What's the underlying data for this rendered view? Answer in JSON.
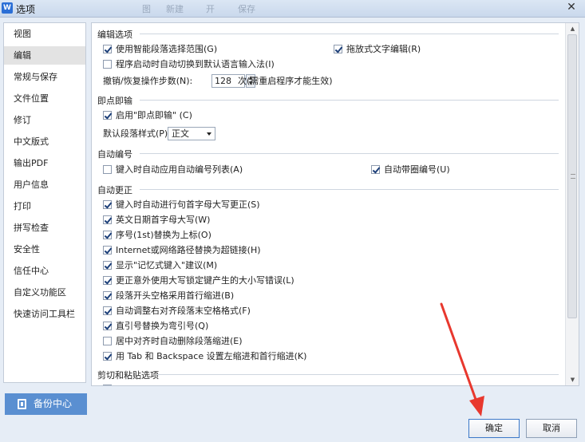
{
  "window": {
    "title": "选项",
    "app_icon": "W",
    "ghost_toolbar": [
      "图",
      "新建",
      "开",
      "保存"
    ]
  },
  "sidebar": {
    "items": [
      {
        "label": "视图"
      },
      {
        "label": "编辑"
      },
      {
        "label": "常规与保存"
      },
      {
        "label": "文件位置"
      },
      {
        "label": "修订"
      },
      {
        "label": "中文版式"
      },
      {
        "label": "输出PDF"
      },
      {
        "label": "用户信息"
      },
      {
        "label": "打印"
      },
      {
        "label": "拼写检查"
      },
      {
        "label": "安全性"
      },
      {
        "label": "信任中心"
      },
      {
        "label": "自定义功能区"
      },
      {
        "label": "快速访问工具栏"
      }
    ],
    "active_index": 1,
    "backup_button": "备份中心"
  },
  "edit_options": {
    "title": "编辑选项",
    "smart_select": {
      "label": "使用智能段落选择范围(G)",
      "checked": true
    },
    "drag_edit": {
      "label": "拖放式文字编辑(R)",
      "checked": true
    },
    "auto_ime": {
      "label": "程序启动时自动切换到默认语言输入法(I)",
      "checked": false
    },
    "undo_label": "撤销/恢复操作步数(N):",
    "undo_value": "128",
    "undo_suffix": "次(需重启程序才能生效)"
  },
  "click_input": {
    "title": "即点即输",
    "enable": {
      "label": "启用\"即点即输\" (C)",
      "checked": true
    },
    "style_label": "默认段落样式(P):",
    "style_value": "正文"
  },
  "auto_number": {
    "title": "自动编号",
    "auto_list": {
      "label": "键入时自动应用自动编号列表(A)",
      "checked": false
    },
    "circled": {
      "label": "自动带圈编号(U)",
      "checked": true
    }
  },
  "auto_correct": {
    "title": "自动更正",
    "items": [
      {
        "label": "键入时自动进行句首字母大写更正(S)",
        "checked": true
      },
      {
        "label": "英文日期首字母大写(W)",
        "checked": true
      },
      {
        "label": "序号(1st)替换为上标(O)",
        "checked": true
      },
      {
        "label": "Internet或网络路径替换为超链接(H)",
        "checked": true
      },
      {
        "label": "显示\"记忆式键入\"建议(M)",
        "checked": true
      },
      {
        "label": "更正意外使用大写锁定键产生的大小写错误(L)",
        "checked": true
      },
      {
        "label": "段落开头空格采用首行缩进(B)",
        "checked": true
      },
      {
        "label": "自动调整右对齐段落末空格格式(F)",
        "checked": true
      },
      {
        "label": "直引号替换为弯引号(Q)",
        "checked": true
      },
      {
        "label": "居中对齐时自动删除段落缩进(E)",
        "checked": false
      },
      {
        "label": "用 Tab 和 Backspace 设置左缩进和首行缩进(K)",
        "checked": true
      }
    ]
  },
  "paste_options": {
    "title": "剪切和粘贴选项"
  },
  "footer": {
    "ok_label": "确定",
    "cancel_label": "取消"
  },
  "colors": {
    "backup_button_bg": "#5a8fd1",
    "annotation_arrow": "#e8382e",
    "checkmark": "#1c3f79"
  }
}
